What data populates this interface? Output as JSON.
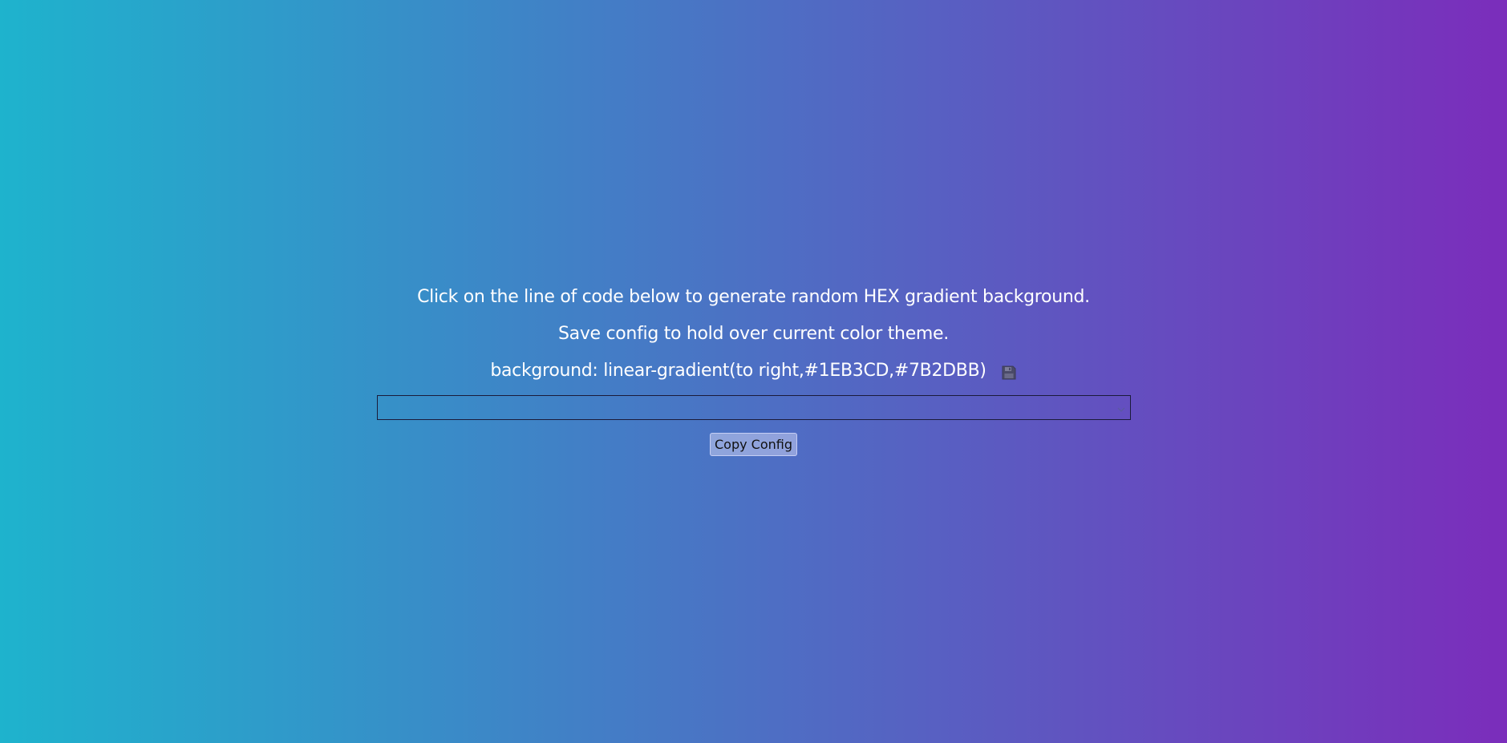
{
  "instructions": {
    "line1": "Click on the line of code below to generate random HEX gradient background.",
    "line2": "Save config to hold over current color theme."
  },
  "code": {
    "text": "background: linear-gradient(to right,#1EB3CD,#7B2DBB)",
    "save_icon": "floppy-disk-icon"
  },
  "config_select": {
    "selected": ""
  },
  "copy_button": {
    "label": "Copy Config"
  },
  "colors": {
    "gradient_start": "#1EB3CD",
    "gradient_end": "#7B2DBB",
    "text": "#FFFFFF"
  }
}
